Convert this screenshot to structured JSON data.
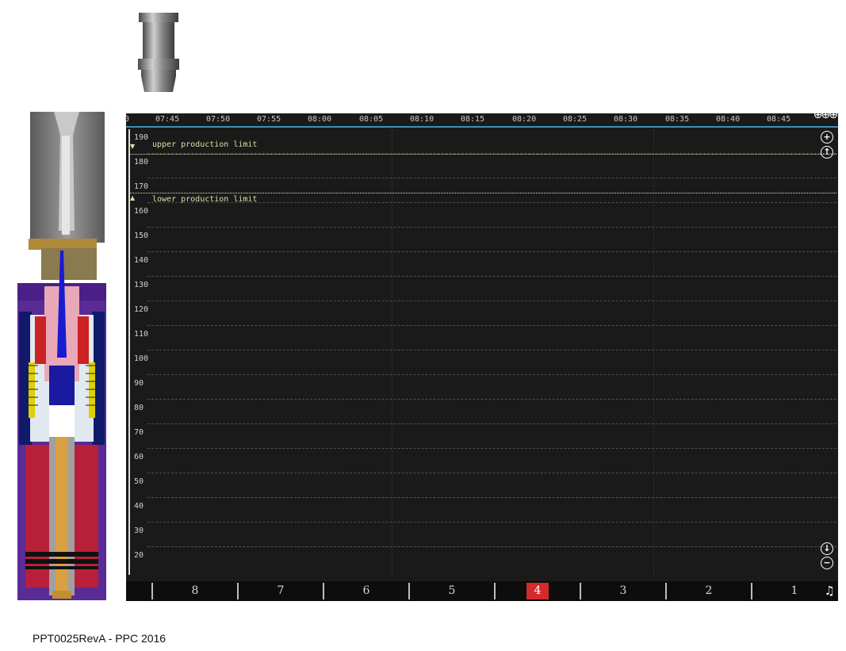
{
  "footer": {
    "text": "PPT0025RevA - PPC 2016"
  },
  "monitor": {
    "time_ticks": [
      "0",
      "07:45",
      "07:50",
      "07:55",
      "08:00",
      "08:05",
      "08:10",
      "08:15",
      "08:20",
      "08:25",
      "08:30",
      "08:35",
      "08:40",
      "08:45"
    ],
    "y_ticks": [
      "190",
      "180",
      "170",
      "160",
      "150",
      "140",
      "130",
      "120",
      "110",
      "100",
      "90",
      "80",
      "70",
      "60",
      "50",
      "40",
      "30",
      "20"
    ],
    "upper_limit_label": "upper production limit",
    "lower_limit_label": "lower production limit",
    "tabs": [
      "8",
      "7",
      "6",
      "5",
      "4",
      "3",
      "2",
      "1"
    ],
    "active_tab": "4",
    "accent_color": "#d42a2a",
    "timebar_color": "#3a8fb5"
  },
  "icons": {
    "zoom_in": "zoom-in-icon",
    "scroll_up": "scroll-up-icon",
    "scroll_down": "scroll-down-icon",
    "zoom_out": "zoom-out-icon",
    "alarm": "alarm-bell-icon"
  }
}
